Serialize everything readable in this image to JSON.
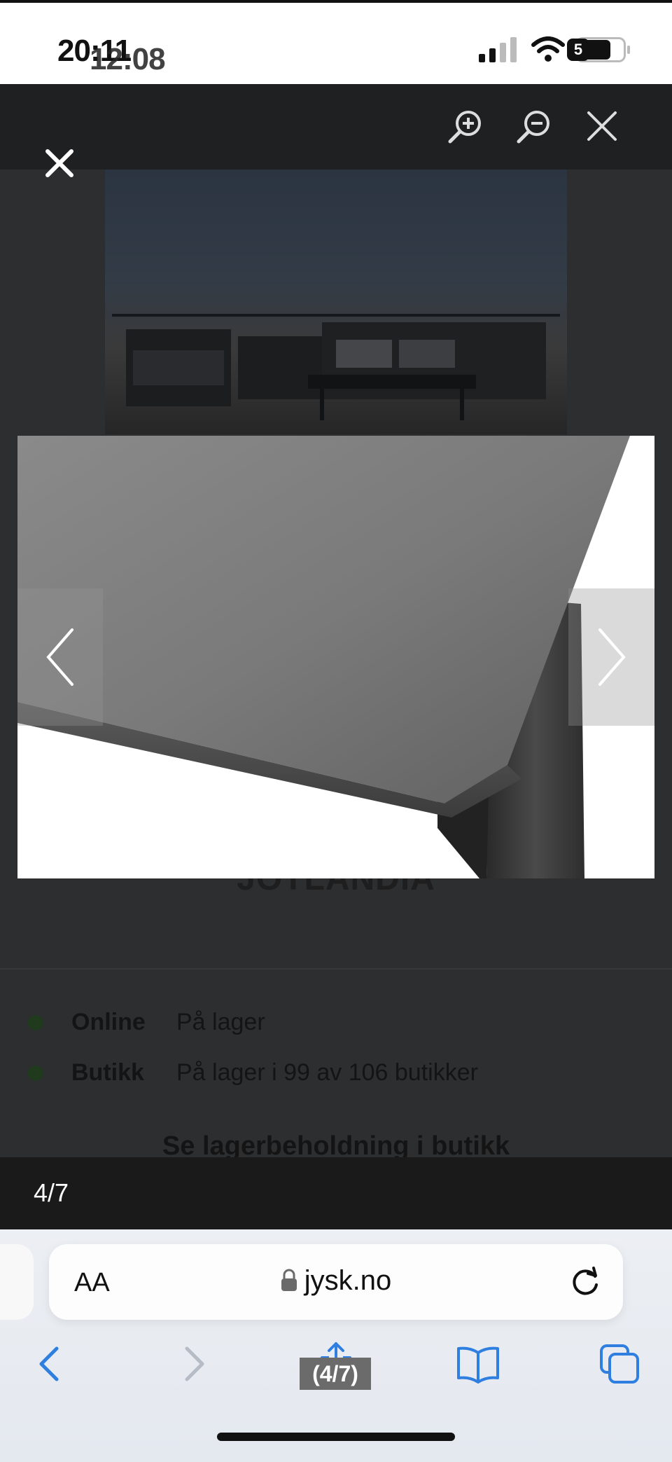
{
  "status_bar": {
    "time": "20:11",
    "time_overlay": "12:08",
    "battery_level": "5"
  },
  "page": {
    "brand": "JOTLANDIA",
    "stock": [
      {
        "label": "Online",
        "value": "På lager"
      },
      {
        "label": "Butikk",
        "value": "På lager i 99 av 106 butikker"
      }
    ],
    "see_stock_link": "Se lagerbeholdning i butikk"
  },
  "viewer": {
    "counter": "4/7",
    "icons": [
      "zoom-in-icon",
      "zoom-out-icon",
      "close-icon",
      "chevron-left-icon",
      "chevron-right-icon"
    ]
  },
  "browser": {
    "text_size_label": "AA",
    "domain": "jysk.no",
    "caption": "(4/7)"
  },
  "colors": {
    "viewer_bar": "#1f2022",
    "dim_page": "#2d2e30",
    "link_blue": "#2f7fe0"
  }
}
